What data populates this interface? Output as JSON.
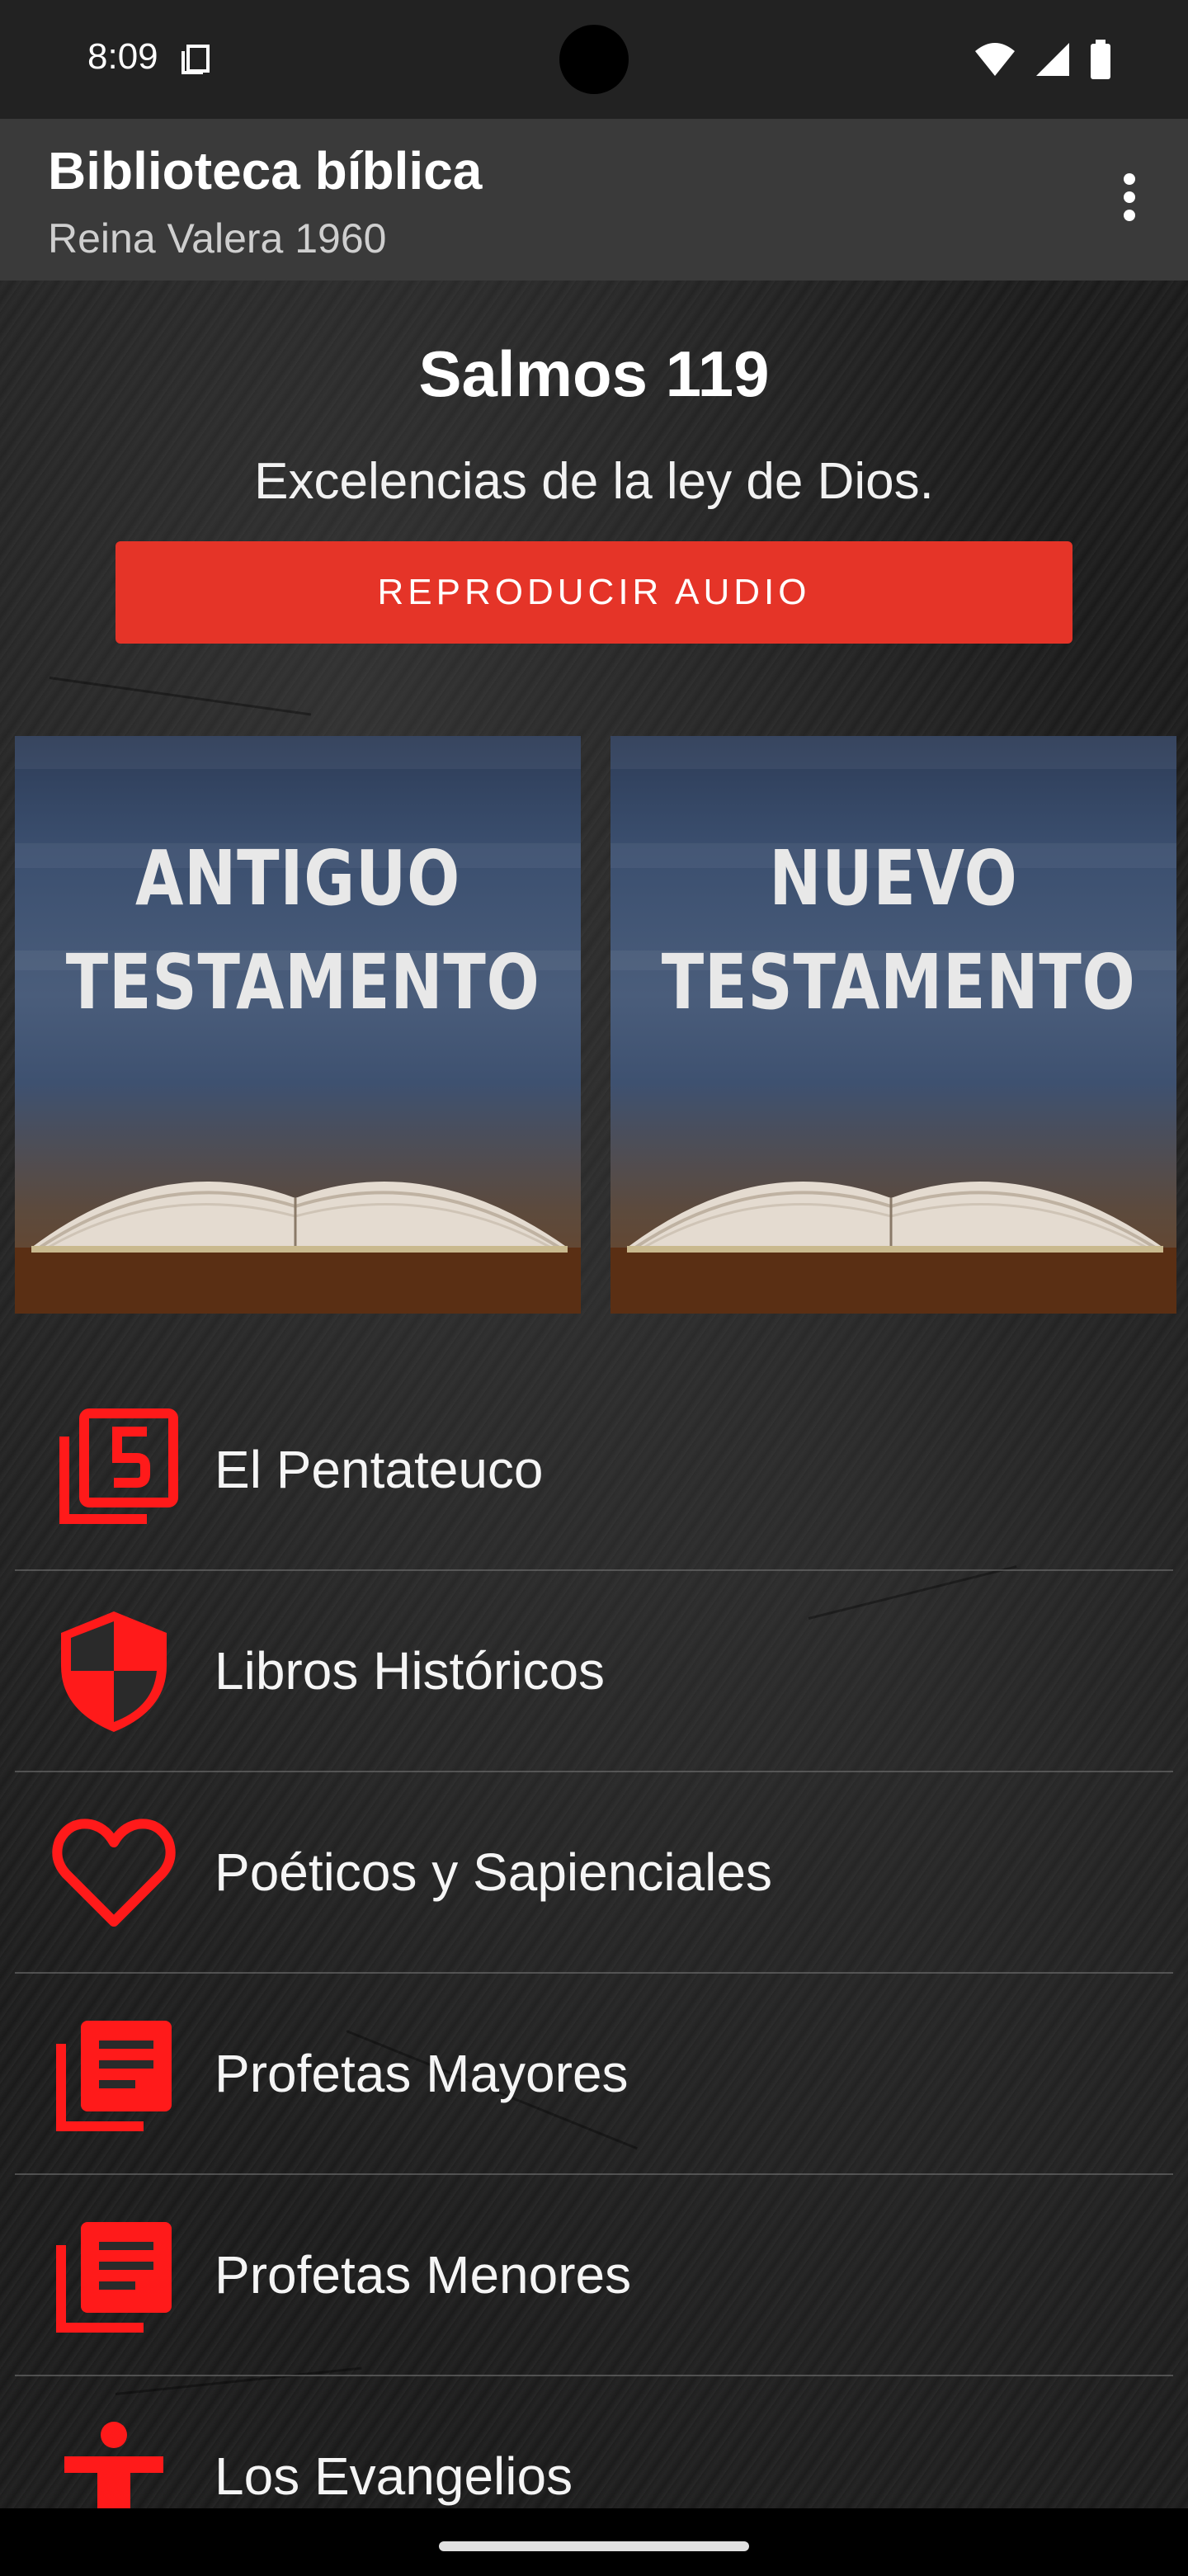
{
  "status_bar": {
    "time": "8:09"
  },
  "app_bar": {
    "title": "Biblioteca bíblica",
    "subtitle": "Reina Valera 1960"
  },
  "verse": {
    "reference": "Salmos 119",
    "description": "Excelencias de la ley de Dios.",
    "audio_button": "REPRODUCIR AUDIO"
  },
  "testaments": {
    "old": [
      "ANTIGUO",
      "TESTAMENTO"
    ],
    "new": [
      "NUEVO",
      "TESTAMENTO"
    ]
  },
  "categories": [
    {
      "label": "El Pentateuco",
      "icon": "filter-5-icon"
    },
    {
      "label": "Libros Históricos",
      "icon": "shield-icon"
    },
    {
      "label": "Poéticos y Sapienciales",
      "icon": "heart-icon"
    },
    {
      "label": "Profetas Mayores",
      "icon": "library-books-icon"
    },
    {
      "label": "Profetas Menores",
      "icon": "library-books-icon"
    },
    {
      "label": "Los Evangelios",
      "icon": "person-icon"
    }
  ],
  "colors": {
    "accent": "#e53428",
    "icon": "#ff1a1a",
    "app_bar": "#3a3a3a",
    "status_bar": "#222222"
  }
}
